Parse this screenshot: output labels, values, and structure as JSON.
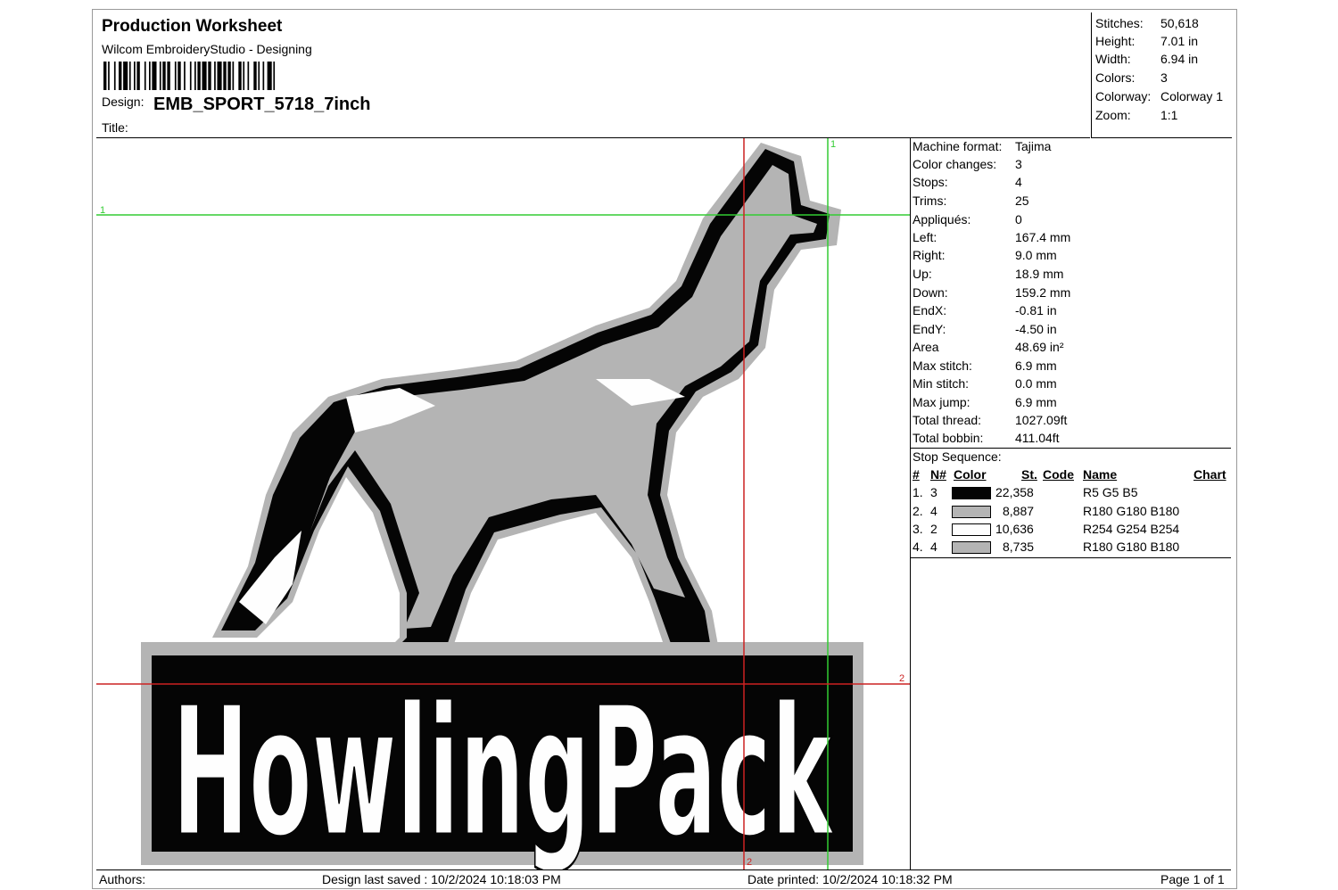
{
  "header": {
    "title": "Production Worksheet",
    "subtitle": "Wilcom EmbroideryStudio - Designing",
    "design_label": "Design:",
    "design_value": "EMB_SPORT_5718_7inch",
    "title_label": "Title:"
  },
  "summary": [
    {
      "label": "Stitches:",
      "value": "50,618"
    },
    {
      "label": "Height:",
      "value": "7.01 in"
    },
    {
      "label": "Width:",
      "value": "6.94 in"
    },
    {
      "label": "Colors:",
      "value": "3"
    },
    {
      "label": "Colorway:",
      "value": "Colorway 1"
    },
    {
      "label": "Zoom:",
      "value": "1:1"
    }
  ],
  "details": [
    {
      "label": "Machine format:",
      "value": "Tajima"
    },
    {
      "label": "Color changes:",
      "value": "3"
    },
    {
      "label": "Stops:",
      "value": "4"
    },
    {
      "label": "Trims:",
      "value": "25"
    },
    {
      "label": "Appliqués:",
      "value": "0"
    },
    {
      "label": "Left:",
      "value": "167.4 mm"
    },
    {
      "label": "Right:",
      "value": "9.0 mm"
    },
    {
      "label": "Up:",
      "value": "18.9 mm"
    },
    {
      "label": "Down:",
      "value": "159.2 mm"
    },
    {
      "label": "EndX:",
      "value": "-0.81 in"
    },
    {
      "label": "EndY:",
      "value": "-4.50 in"
    },
    {
      "label": "Area",
      "value": " 48.69 in²"
    },
    {
      "label": "Max stitch:",
      "value": "6.9 mm"
    },
    {
      "label": "Min stitch:",
      "value": "0.0 mm"
    },
    {
      "label": "Max jump:",
      "value": "6.9 mm"
    },
    {
      "label": "Total thread:",
      "value": "1027.09ft"
    },
    {
      "label": "Total bobbin:",
      "value": "411.04ft"
    }
  ],
  "stop_sequence": {
    "title": "Stop Sequence:",
    "columns": {
      "num": "#",
      "needle": "N#",
      "color": "Color",
      "stitches": "St.",
      "code": "Code",
      "name": "Name",
      "chart": "Chart"
    },
    "rows": [
      {
        "num": "1.",
        "needle": "3",
        "color": "#050505",
        "stitches": "22,358",
        "code": "",
        "name": "R5 G5 B5"
      },
      {
        "num": "2.",
        "needle": "4",
        "color": "#b4b4b4",
        "stitches": "8,887",
        "code": "",
        "name": "R180 G180 B180"
      },
      {
        "num": "3.",
        "needle": "2",
        "color": "#fefefe",
        "stitches": "10,636",
        "code": "",
        "name": "R254 G254 B254"
      },
      {
        "num": "4.",
        "needle": "4",
        "color": "#b4b4b4",
        "stitches": "8,735",
        "code": "",
        "name": "R180 G180 B180"
      }
    ]
  },
  "design_preview": {
    "text": "HowlingPack",
    "guide_labels": {
      "green_top": "1",
      "green_left": "1",
      "red_right": "2",
      "red_bottom": "2"
    },
    "colors": {
      "outline": "#050505",
      "fill": "#b4b4b4",
      "highlight": "#fefefe",
      "guide_green": "#33cc33",
      "guide_red": "#cc2222"
    }
  },
  "footer": {
    "authors": "Authors:",
    "saved": "Design last saved : 10/2/2024 10:18:03 PM",
    "printed": "Date printed: 10/2/2024 10:18:32 PM",
    "page": "Page 1 of 1"
  }
}
